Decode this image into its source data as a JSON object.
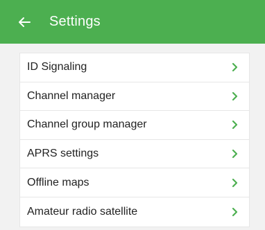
{
  "app_bar": {
    "title": "Settings",
    "back_icon": "arrow-left-icon",
    "background_color": "#4caf50"
  },
  "settings_list": {
    "chevron_icon": "chevron-right-icon",
    "accent_color": "#4caf50",
    "items": [
      {
        "label": "ID Signaling"
      },
      {
        "label": "Channel manager"
      },
      {
        "label": "Channel group manager"
      },
      {
        "label": "APRS settings"
      },
      {
        "label": "Offline maps"
      },
      {
        "label": "Amateur radio satellite"
      }
    ]
  }
}
